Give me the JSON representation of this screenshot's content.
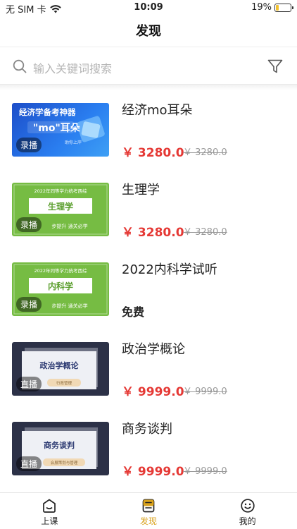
{
  "status_bar": {
    "carrier": "无 SIM 卡",
    "time": "10:09",
    "battery": "19%",
    "battery_level": 0.19
  },
  "header": {
    "title": "发现"
  },
  "search": {
    "placeholder": "输入关键词搜索"
  },
  "courses": [
    {
      "title": "经济mo耳朵",
      "tag": "录播",
      "price": "￥ 3280.0",
      "original_price": "￥ 3280.0",
      "thumb": {
        "headline": "经济学备考神器",
        "sub": "\"mo\"耳朵",
        "caption": "助你上岸"
      }
    },
    {
      "title": "生理学",
      "tag": "录播",
      "price": "￥ 3280.0",
      "original_price": "￥ 3280.0",
      "thumb": {
        "headline": "2022年同等学力统考西综",
        "sub": "生理学",
        "caption": "步提升 通关必学"
      }
    },
    {
      "title": "2022内科学试听",
      "tag": "录播",
      "free": "免费",
      "thumb": {
        "headline": "2022年同等学力统考西综",
        "sub": "内科学",
        "caption": "步提升 通关必学"
      }
    },
    {
      "title": "政治学概论",
      "tag": "直播",
      "price": "￥ 9999.0",
      "original_price": "￥ 9999.0",
      "thumb": {
        "sub": "政治学概论",
        "caption": "行政管理"
      }
    },
    {
      "title": "商务谈判",
      "tag": "直播",
      "price": "￥ 9999.0",
      "original_price": "￥ 9999.0",
      "thumb": {
        "sub": "商务谈判",
        "caption": "会展策划与管理"
      }
    }
  ],
  "tabs": [
    {
      "label": "上课",
      "icon": "classroom-icon",
      "active": false
    },
    {
      "label": "发现",
      "icon": "discover-icon",
      "active": true
    },
    {
      "label": "我的",
      "icon": "smiley-icon",
      "active": false
    }
  ],
  "colors": {
    "accent": "#d9a21c",
    "price": "#e53935",
    "green_thumb": "#76bc43",
    "blue_thumb": "#2a7ef0",
    "dark_thumb": "#2c3147"
  }
}
